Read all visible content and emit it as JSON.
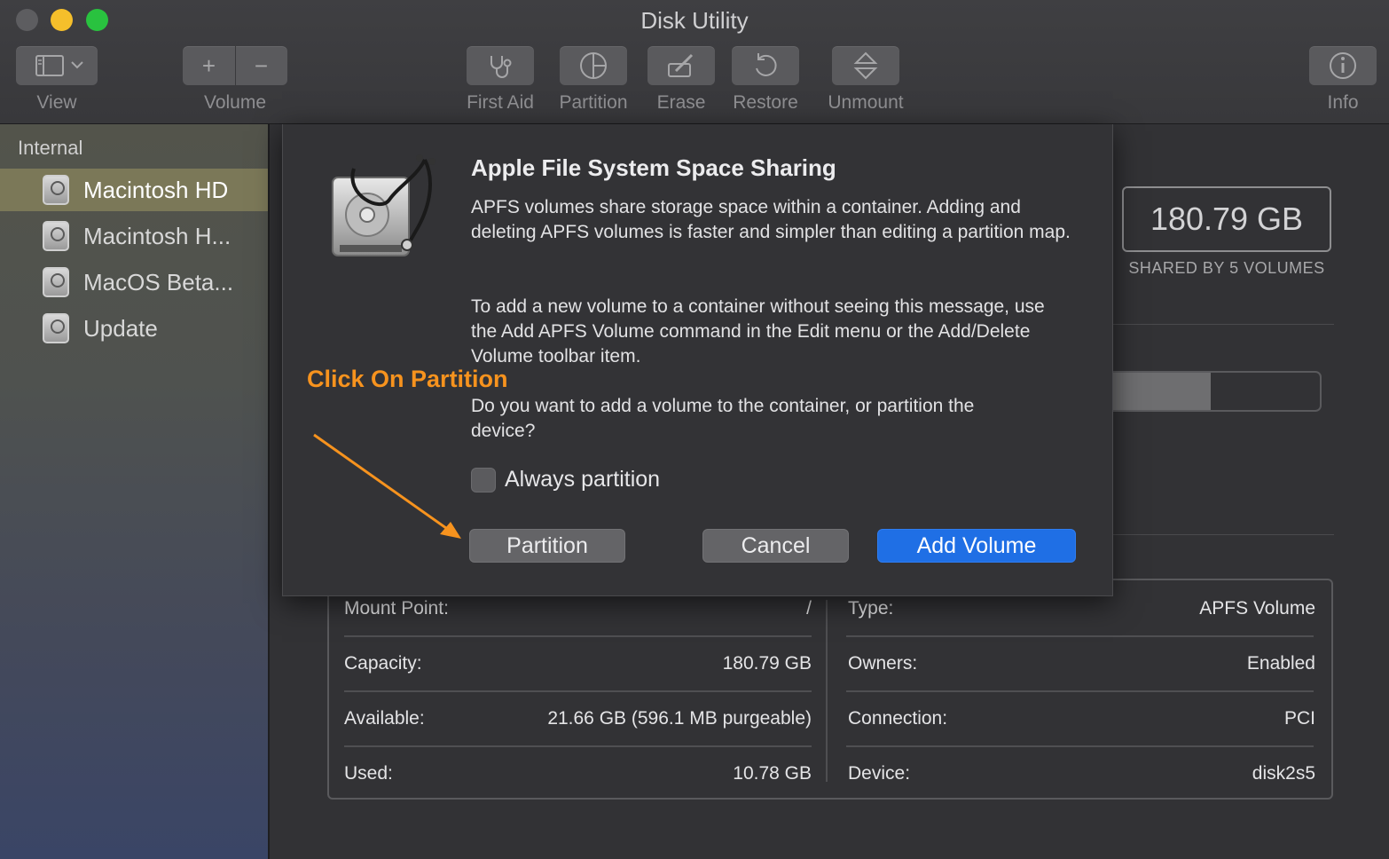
{
  "window": {
    "title": "Disk Utility"
  },
  "toolbar": {
    "view_label": "View",
    "volume_label": "Volume",
    "first_aid_label": "First Aid",
    "partition_label": "Partition",
    "erase_label": "Erase",
    "restore_label": "Restore",
    "unmount_label": "Unmount",
    "info_label": "Info",
    "volume_add_glyph": "+",
    "volume_remove_glyph": "−"
  },
  "sidebar": {
    "section": "Internal",
    "items": [
      {
        "label": "Macintosh HD",
        "selected": true
      },
      {
        "label": "Macintosh H...",
        "selected": false
      },
      {
        "label": "MacOS Beta...",
        "selected": false
      },
      {
        "label": "Update",
        "selected": false
      }
    ]
  },
  "summary": {
    "capacity": "180.79 GB",
    "capacity_sub": "SHARED BY 5 VOLUMES",
    "used_fraction": 0.52
  },
  "details": {
    "left": [
      {
        "key": "Mount Point:",
        "value": "/"
      },
      {
        "key": "Capacity:",
        "value": "180.79 GB"
      },
      {
        "key": "Available:",
        "value": "21.66 GB (596.1 MB purgeable)"
      },
      {
        "key": "Used:",
        "value": "10.78 GB"
      }
    ],
    "right": [
      {
        "key": "Type:",
        "value": "APFS Volume"
      },
      {
        "key": "Owners:",
        "value": "Enabled"
      },
      {
        "key": "Connection:",
        "value": "PCI"
      },
      {
        "key": "Device:",
        "value": "disk2s5"
      }
    ]
  },
  "dialog": {
    "title": "Apple File System Space Sharing",
    "para1": "APFS volumes share storage space within a container. Adding and deleting APFS volumes is faster and simpler than editing a partition map.",
    "para2": "To add a new volume to a container without seeing this message, use the Add APFS Volume command in the Edit menu or the Add/Delete Volume toolbar item.",
    "para3": "Do you want to add a volume to the container, or partition the device?",
    "checkbox_label": "Always partition",
    "checkbox_checked": false,
    "partition_button": "Partition",
    "cancel_button": "Cancel",
    "add_volume_button": "Add Volume"
  },
  "annotation": {
    "text": "Click On Partition",
    "color": "#f7931e"
  }
}
